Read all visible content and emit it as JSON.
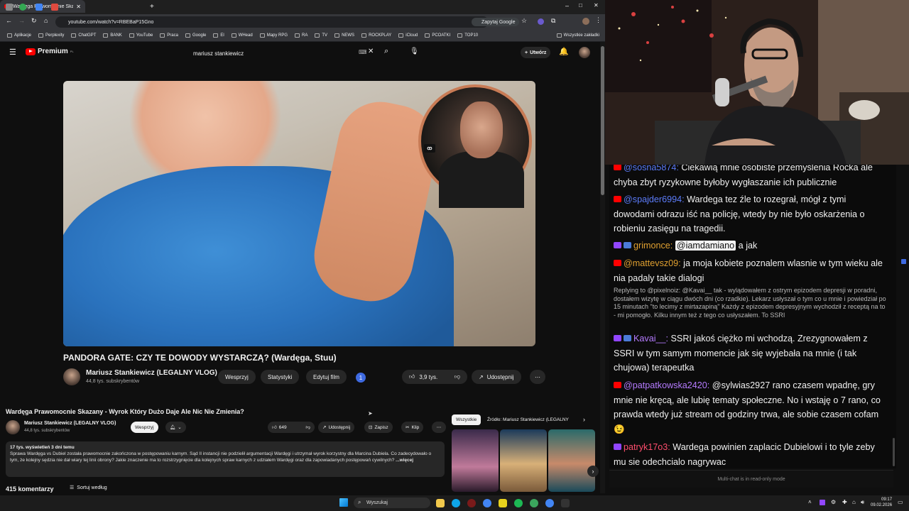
{
  "browser": {
    "active_tab_title": "Wardęga Prawomocnie Skazany",
    "url": "youtube.com/watch?v=RBEBaP15Gno",
    "ask_google": "Zapytaj Google",
    "bookmarks": [
      "Aplikacje",
      "Perplexity",
      "ChatGPT",
      "BANK",
      "YouTube",
      "Praca",
      "Google",
      "El",
      "WHead",
      "Mapy RPG",
      "RA",
      "TV",
      "NEWS",
      "ROCKPLAY",
      "iCloud",
      "PCOATKI",
      "TOP10"
    ],
    "all_bookmarks": "Wszystkie zakładki"
  },
  "youtube": {
    "logo": "Premium",
    "logo_region": "PL",
    "search_query": "mariusz stankiewicz",
    "create_label": "Utwórz",
    "video": {
      "title": "PANDORA GATE: CZY TE DOWODY WYSTARCZĄ? (Wardęga, Stuu)",
      "channel": "Mariusz Stankiewicz (LEGALNY VLOG)",
      "subscribers": "44,8 tys. subskrybentów",
      "support": "Wesprzyj",
      "stats": "Statystyki",
      "edit": "Edytuj film",
      "badge": "1",
      "likes": "3,9 tys.",
      "share": "Udostępnij"
    },
    "video2": {
      "title": "Wardęga Prawomocnie Skazany - Wyrok Który Dużo Daje Ale Nic Nie Zmienia?",
      "channel": "Mariusz Stankiewicz (LEGALNY VLOG)",
      "subscribers": "44,8 tys. subskrybentów",
      "support": "Wesprzyj",
      "likes": "649",
      "share": "Udostępnij",
      "save": "Zapisz",
      "clip": "Klip",
      "views_date": "17 tys. wyświetleń  3 dni temu",
      "description": "Sprawa Wardęga vs Dubiel została prawomocnie zakończona w postępowaniu karnym. Sąd II instancji nie podzielił argumentacji Wardęgi i utrzymał wyrok korzystny dla Marcina Dubiela. Co zadecydowało o tym, że kolejny sędzia nie dał wiary tej linii obrony? Jakie znaczenie ma to rozstrzygnięcie dla kolejnych spraw karnych z udziałem Wardęgi oraz dla zapowiadanych postępowań cywilnych?",
      "more": "...więcej",
      "comments_count": "415 komentarzy",
      "sort_by": "Sortuj według"
    },
    "chips": {
      "all": "Wszystkie",
      "source": "Źródło: Mariusz Stankiewicz (LEGALNY"
    }
  },
  "chat": {
    "messages": [
      {
        "platform": "youtube",
        "user": "@sosna5874:",
        "text": " Ciekawią mnie osobiste przemyślenia Rocka ale chyba zbyt ryzykowne byłoby wygłaszanie ich publicznie",
        "color": "#5c7cfa"
      },
      {
        "platform": "youtube",
        "user": "@spajder6994:",
        "text": " Wardega tez źle to rozegrał, mógł z tymi dowodami odrazu iść na policję, wtedy by nie było oskarżenia o robieniu zasięgu na tragedii.",
        "color": "#5c7cfa"
      },
      {
        "platform": "twitch",
        "user": "grimonce:",
        "mention": "@iamdamiano",
        "text": " a jak",
        "color": "#e0a030"
      },
      {
        "platform": "youtube",
        "user": "@mattevsz09:",
        "text": " ja moja kobiete poznalem wlasnie w tym wieku ale nia padaly takie dialogi",
        "color": "#e0a030"
      },
      {
        "platform": "reply",
        "text": "Replying to @pixelnoiz: @Kavai__ tak - wylądowałem z ostrym epizodem depresji w poradni, dostałem wizytę w ciągu dwóch dni (co rzadkie). Lekarz usłyszał o tym co u mnie i powiedział po 15 minutach \"to lecimy z mirtazapiną\" Każdy z epizodem depresyjnym wychodził z receptą na to - mi pomogło. Kilku innym też z tego co usłyszałem. To SSRI"
      },
      {
        "platform": "twitch",
        "user": "Kavai__:",
        "text": " SSRI jakoś ciężko mi wchodzą. Zrezygnowałem z SSRI w tym samym momencie jak się wyjebała na mnie (i tak chujowa) terapeutka",
        "color": "#b57bff"
      },
      {
        "platform": "youtube",
        "user": "@patpatkowska2420:",
        "text": " @sylwias2927 rano czasem wpadnę, gry mnie nie kręcą, ale lubię tematy społeczne. No i wstaję o 7 rano, co prawda wtedy już stream od godziny trwa, ale sobie czasem cofam",
        "emoji": "😉",
        "color": "#b57bff"
      },
      {
        "platform": "twitch",
        "user": "patryk17o3:",
        "text": " Wardega powinien zaplacic Dubielowi i to tyle zeby mu sie odechcialo nagrywac",
        "color": "#ff4d6d"
      }
    ],
    "footer": "Multi-chat is in read-only mode"
  },
  "taskbar": {
    "search": "Wyszukaj",
    "time": "09:17",
    "date": "09.02.2026"
  }
}
